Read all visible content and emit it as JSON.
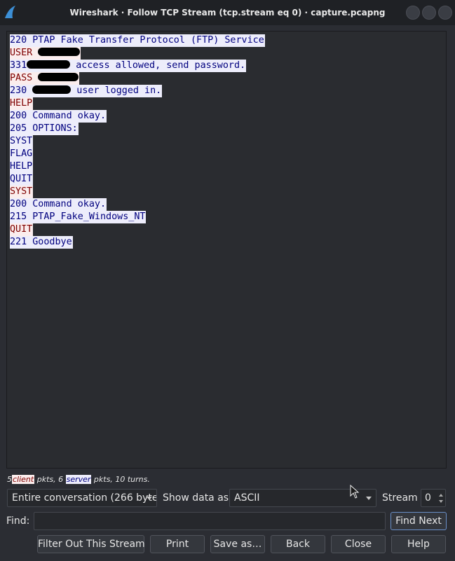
{
  "window": {
    "title": "Wireshark · Follow TCP Stream (tcp.stream eq 0) · capture.pcapng"
  },
  "stream": {
    "lines": [
      {
        "side": "server",
        "text": "220 PTAP Fake Transfer Protocol (FTP) Service"
      },
      {
        "side": "client",
        "text": "USER ",
        "redacted": true
      },
      {
        "side": "server",
        "text": "331",
        "redacted": true,
        "text_after": " access allowed, send password."
      },
      {
        "side": "client",
        "text": "PASS ",
        "redacted": true
      },
      {
        "side": "server",
        "text": "230 ",
        "redacted": true,
        "text_after": " user logged in."
      },
      {
        "side": "client",
        "text": "HELP"
      },
      {
        "side": "server",
        "text": "200 Command okay."
      },
      {
        "side": "server",
        "text": "205 OPTIONS:"
      },
      {
        "side": "server",
        "text": "SYST"
      },
      {
        "side": "server",
        "text": "FLAG"
      },
      {
        "side": "server",
        "text": "HELP"
      },
      {
        "side": "server",
        "text": "QUIT"
      },
      {
        "side": "client",
        "text": "SYST"
      },
      {
        "side": "server",
        "text": "200 Command okay."
      },
      {
        "side": "server",
        "text": "215 PTAP_Fake_Windows_NT"
      },
      {
        "side": "client",
        "text": "QUIT"
      },
      {
        "side": "server",
        "text": "221 Goodbye"
      }
    ]
  },
  "stats": {
    "client_count": "5",
    "client_label": "client",
    "middle": " pkts, 6 ",
    "server_label": "server",
    "tail": " pkts, 10 turns."
  },
  "controls": {
    "conversation_select": "Entire conversation (266 byte",
    "show_data_label": "Show data as",
    "show_data_select": "ASCII",
    "stream_label": "Stream",
    "stream_value": "0",
    "find_label": "Find:",
    "find_value": "",
    "find_next": "Find Next"
  },
  "buttons": {
    "filter_out": "Filter Out This Stream",
    "print": "Print",
    "save_as": "Save as…",
    "back": "Back",
    "close": "Close",
    "help": "Help"
  },
  "colors": {
    "client_bg": "#fbeded",
    "client_fg": "#7f0000",
    "server_bg": "#ededfb",
    "server_fg": "#00007f"
  }
}
